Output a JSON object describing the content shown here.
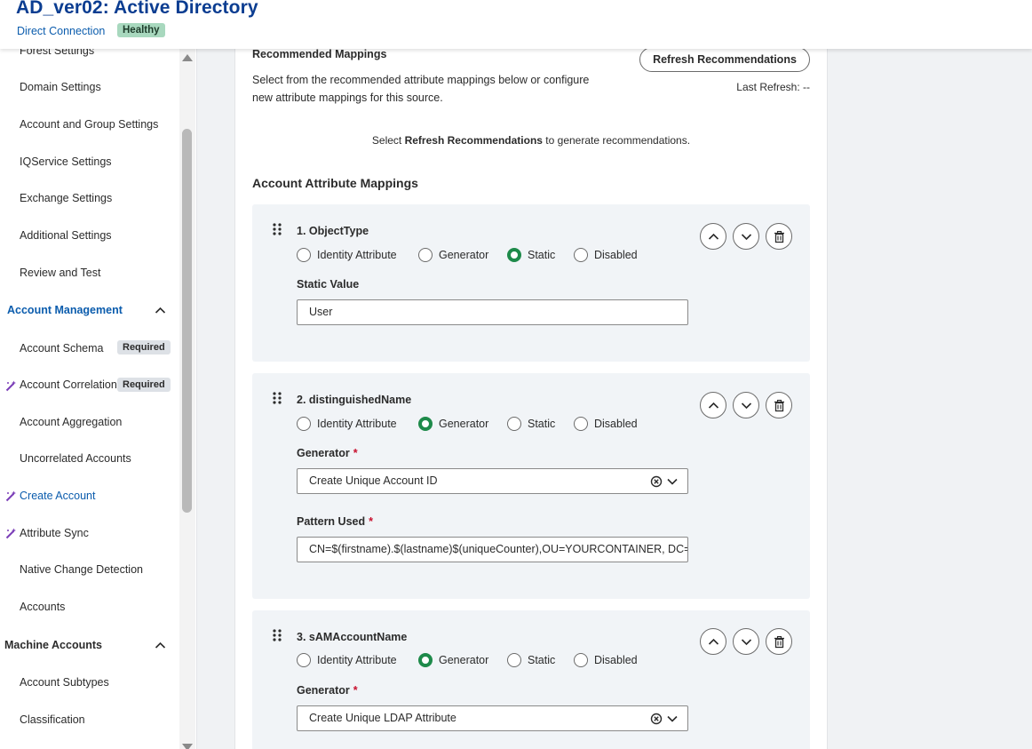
{
  "header": {
    "title": "AD_ver02: Active Directory",
    "connection": "Direct Connection",
    "status": "Healthy"
  },
  "sidebar": {
    "items_top": [
      "Forest Settings",
      "Domain Settings",
      "Account and Group Settings",
      "IQService Settings",
      "Exchange Settings",
      "Additional Settings",
      "Review and Test"
    ],
    "section_account": "Account Management",
    "account_items": [
      "Account Schema",
      "Account Correlation",
      "Account Aggregation",
      "Uncorrelated Accounts",
      "Create Account",
      "Attribute Sync",
      "Native Change Detection",
      "Accounts"
    ],
    "required_label": "Required",
    "section_machine": "Machine Accounts",
    "machine_items": [
      "Account Subtypes",
      "Classification"
    ]
  },
  "main": {
    "recommended_title": "Recommended Mappings",
    "recommended_desc": "Select from the recommended attribute mappings below or configure new attribute mappings for this source.",
    "refresh_button": "Refresh Recommendations",
    "last_refresh": "Last Refresh: --",
    "hint_before": "Select ",
    "hint_bold": "Refresh Recommendations",
    "hint_after": " to generate recommendations.",
    "section_title": "Account Attribute Mappings",
    "radio_options": [
      "Identity Attribute",
      "Generator",
      "Static",
      "Disabled"
    ],
    "mappings": [
      {
        "title": "1. ObjectType",
        "selected": "Static",
        "field_label": "Static Value",
        "value": "User"
      },
      {
        "title": "2. distinguishedName",
        "selected": "Generator",
        "field_label": "Generator",
        "value": "Create Unique Account ID",
        "field2_label": "Pattern Used",
        "value2": "CN=$(firstname).$(lastname)$(uniqueCounter),OU=YOURCONTAINER, DC='"
      },
      {
        "title": "3. sAMAccountName",
        "selected": "Generator",
        "field_label": "Generator",
        "value": "Create Unique LDAP Attribute"
      }
    ]
  },
  "colors": {
    "brand_blue": "#0b3d91",
    "link_blue": "#0b5cad",
    "radio_green": "#1e8a4a",
    "required_red": "#c8102e",
    "healthy_bg": "#a8d8be"
  }
}
